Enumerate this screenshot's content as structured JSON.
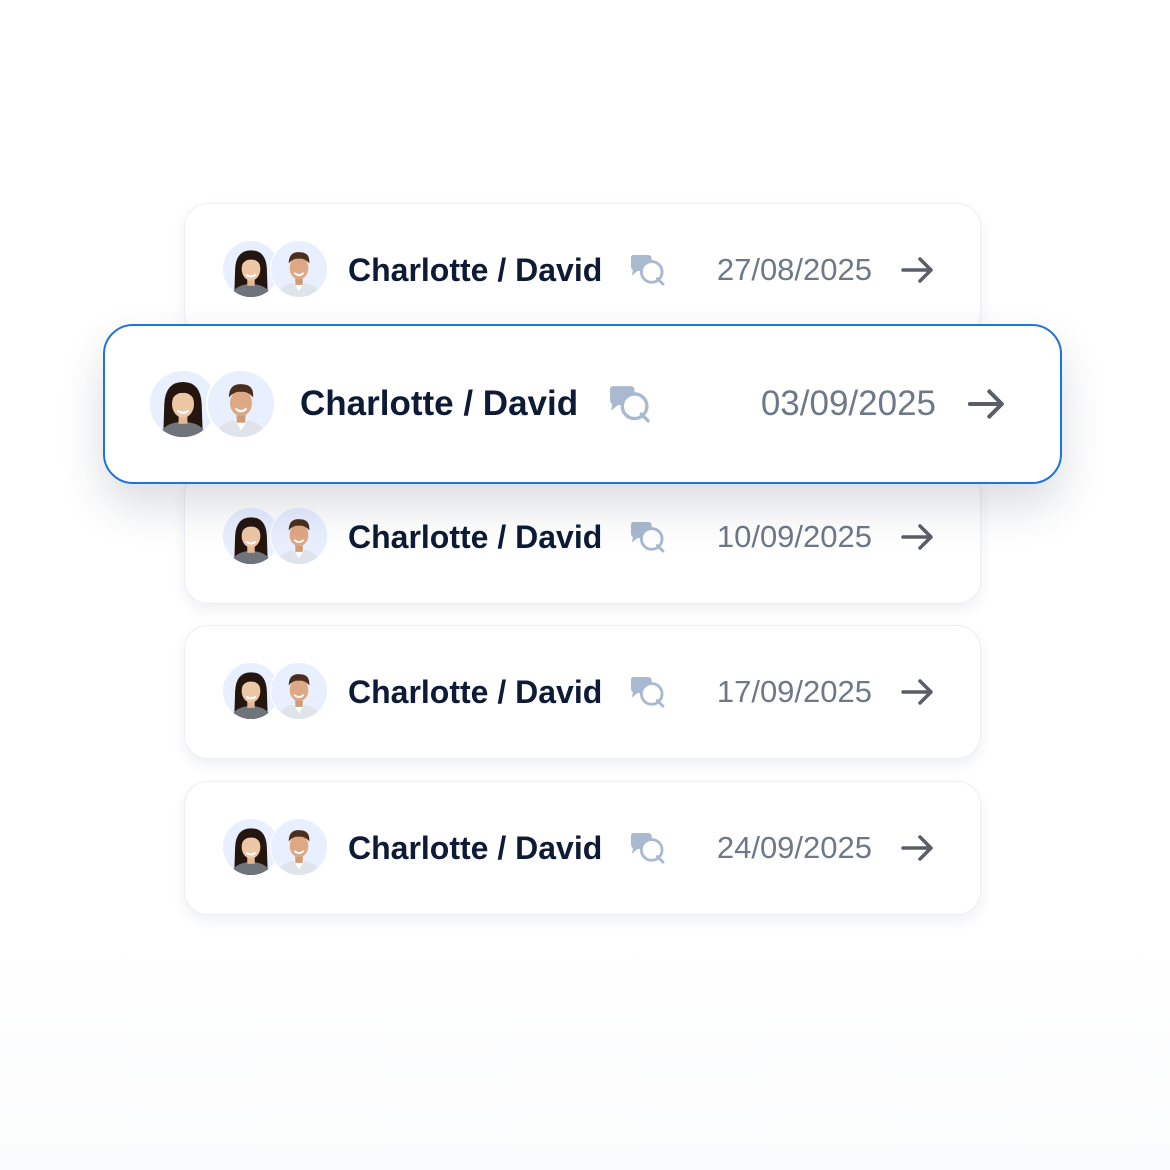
{
  "sessions": [
    {
      "names": "Charlotte / David",
      "date": "27/08/2025",
      "selected": false
    },
    {
      "names": "Charlotte / David",
      "date": "03/09/2025",
      "selected": true
    },
    {
      "names": "Charlotte / David",
      "date": "10/09/2025",
      "selected": false
    },
    {
      "names": "Charlotte / David",
      "date": "17/09/2025",
      "selected": false
    },
    {
      "names": "Charlotte / David",
      "date": "24/09/2025",
      "selected": false
    }
  ],
  "icons": {
    "chat": "chat-bubbles-icon",
    "arrow": "arrow-right-icon"
  },
  "colors": {
    "accent_border": "#1f74d8",
    "name_text": "#0d1b36",
    "date_text": "#6d7889",
    "chat_icon": "#a9b9cf",
    "arrow_icon": "#5a5e67"
  }
}
